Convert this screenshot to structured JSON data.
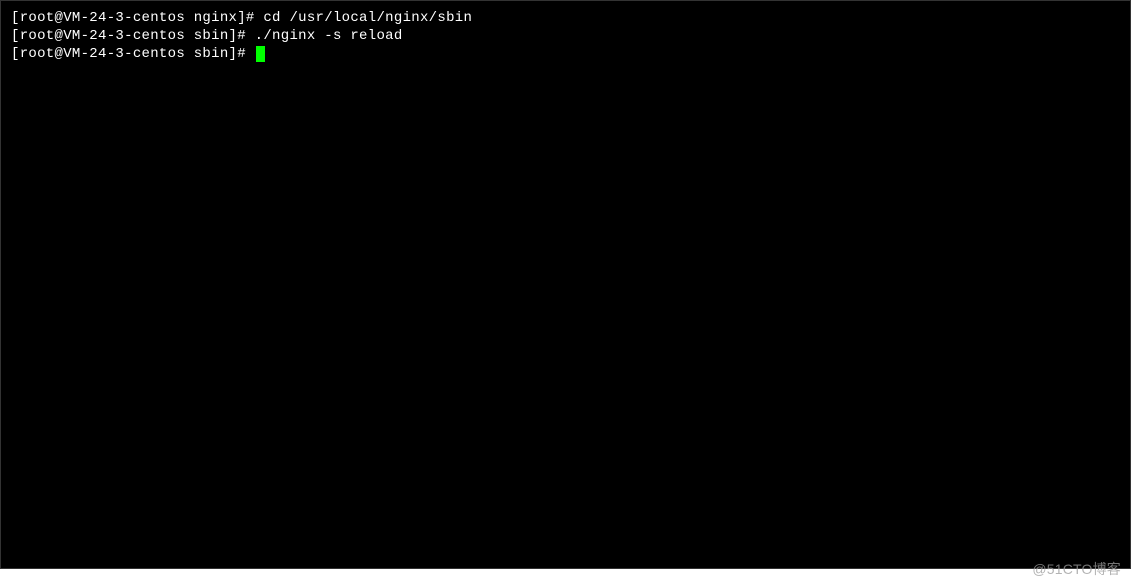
{
  "terminal": {
    "lines": [
      {
        "prefix": "[root@VM-24-3-centos nginx]# ",
        "command": "cd /usr/local/nginx/sbin",
        "cursor": false
      },
      {
        "prefix": "[root@VM-24-3-centos sbin]# ",
        "command": "./nginx -s reload",
        "cursor": false
      },
      {
        "prefix": "[root@VM-24-3-centos sbin]# ",
        "command": "",
        "cursor": true
      }
    ]
  },
  "watermark": "@51CTO博客"
}
